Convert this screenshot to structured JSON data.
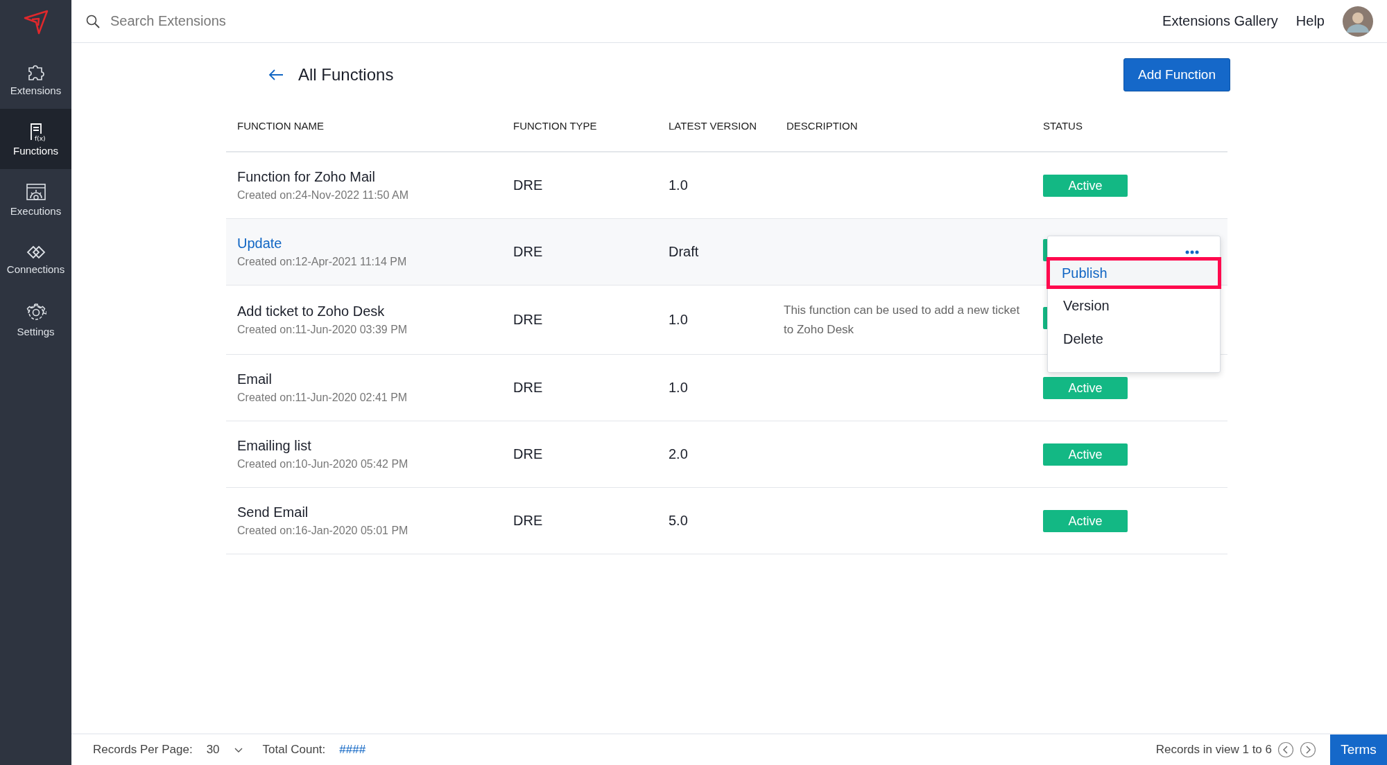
{
  "sidebar": {
    "items": [
      {
        "label": "Extensions",
        "selected": false
      },
      {
        "label": "Functions",
        "icon_label": "f(x)",
        "selected": true
      },
      {
        "label": "Executions",
        "selected": false
      },
      {
        "label": "Connections",
        "selected": false
      },
      {
        "label": "Settings",
        "selected": false
      }
    ]
  },
  "topbar": {
    "search": {
      "placeholder": "Search Extensions"
    },
    "links": [
      "Extensions Gallery",
      "Help"
    ]
  },
  "page": {
    "title": "All Functions",
    "add_button": "Add Function"
  },
  "table": {
    "columns": [
      "FUNCTION NAME",
      "FUNCTION TYPE",
      "LATEST VERSION",
      "DESCRIPTION",
      "STATUS"
    ],
    "rows": [
      {
        "name": "Function for Zoho Mail",
        "created": "Created on:24-Nov-2022 11:50 AM",
        "type": "DRE",
        "version": "1.0",
        "status": "Active",
        "selected": false
      },
      {
        "name": "Update",
        "created": "Created on:12-Apr-2021 11:14 PM",
        "type": "DRE",
        "version": "Draft",
        "selected": true
      },
      {
        "name": "Add ticket to Zoho Desk",
        "created": "Created on:11-Jun-2020 03:39 PM",
        "type": "DRE",
        "version": "1.0",
        "description": "This function can be used to add a new ticket to Zoho Desk",
        "selected": false
      },
      {
        "name": "Email",
        "created": "Created on:11-Jun-2020 02:41 PM",
        "type": "DRE",
        "version": "1.0",
        "status": "Active",
        "selected": false
      },
      {
        "name": "Emailing list",
        "created": "Created on:10-Jun-2020 05:42 PM",
        "type": "DRE",
        "version": "2.0",
        "status": "Active",
        "selected": false
      },
      {
        "name": "Send Email",
        "created": "Created on:16-Jan-2020 05:01 PM",
        "type": "DRE",
        "version": "5.0",
        "status": "Active",
        "selected": false
      }
    ]
  },
  "context_menu": {
    "items": [
      {
        "label": "Publish",
        "selected": true
      },
      {
        "label": "Version",
        "selected": false
      },
      {
        "label": "Delete",
        "selected": false
      }
    ]
  },
  "footer": {
    "per_page_label": "Records Per Page:",
    "per_page": "30",
    "total_label": "Total Count:",
    "total": "####",
    "range": "Records in view 1 to 6",
    "terms": "Terms"
  }
}
